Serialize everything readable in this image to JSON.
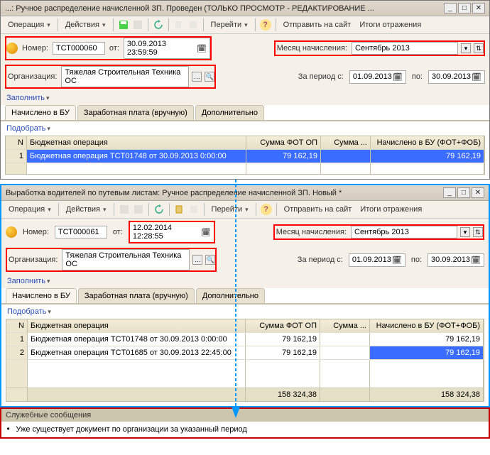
{
  "win1": {
    "title": "...: Ручное распределение начисленной ЗП. Проведен (ТОЛЬКО ПРОСМОТР - РЕДАКТИРОВАНИЕ ...",
    "toolbar": {
      "operation": "Операция",
      "actions": "Действия",
      "goto": "Перейти",
      "send": "Отправить на сайт",
      "totals": "Итоги отражения"
    },
    "row1": {
      "number_label": "Номер:",
      "number": "ТСТ000060",
      "from_label": "от:",
      "from": "30.09.2013 23:59:59",
      "month_label": "Месяц начисления:",
      "month": "Сентябрь 2013"
    },
    "row2": {
      "org_label": "Организация:",
      "org": "Тяжелая Строительная Техника ОС",
      "period_label": "За период с:",
      "period_from": "01.09.2013",
      "period_to_label": "по:",
      "period_to": "30.09.2013"
    },
    "fill": "Заполнить",
    "tabs": {
      "t1": "Начислено в БУ",
      "t2": "Заработная плата (вручную)",
      "t3": "Дополнительно"
    },
    "pick": "Подобрать",
    "cols": {
      "n": "N",
      "op": "Бюджетная операция",
      "fot": "Сумма ФОТ ОП",
      "sum": "Сумма ...",
      "nach": "Начислено в БУ (ФОТ+ФОБ)"
    },
    "rows": [
      {
        "n": "1",
        "op": "Бюджетная операция TCT01748 от 30.09.2013 0:00:00",
        "fot": "79 162,19",
        "sum": "",
        "nach": "79 162,19"
      }
    ]
  },
  "win2": {
    "title": "Выработка водителей по путевым листам: Ручное распределение начисленной ЗП. Новый *",
    "toolbar": {
      "operation": "Операция",
      "actions": "Действия",
      "goto": "Перейти",
      "send": "Отправить на сайт",
      "totals": "Итоги отражения"
    },
    "row1": {
      "number_label": "Номер:",
      "number": "ТСТ000061",
      "from_label": "от:",
      "from": "12.02.2014 12:28:55",
      "month_label": "Месяц начисления:",
      "month": "Сентябрь 2013"
    },
    "row2": {
      "org_label": "Организация:",
      "org": "Тяжелая Строительная Техника ОС",
      "period_label": "За период с:",
      "period_from": "01.09.2013",
      "period_to_label": "по:",
      "period_to": "30.09.2013"
    },
    "fill": "Заполнить",
    "tabs": {
      "t1": "Начислено в БУ",
      "t2": "Заработная плата (вручную)",
      "t3": "Дополнительно"
    },
    "pick": "Подобрать",
    "cols": {
      "n": "N",
      "op": "Бюджетная операция",
      "fot": "Сумма ФОТ ОП",
      "sum": "Сумма ...",
      "nach": "Начислено в БУ (ФОТ+ФОБ)"
    },
    "rows": [
      {
        "n": "1",
        "op": "Бюджетная операция TCT01748 от 30.09.2013 0:00:00",
        "fot": "79 162,19",
        "sum": "",
        "nach": "79 162,19"
      },
      {
        "n": "2",
        "op": "Бюджетная операция TCT01685 от 30.09.2013 22:45:00",
        "fot": "79 162,19",
        "sum": "",
        "nach": "79 162,19"
      }
    ],
    "totals": {
      "fot": "158 324,38",
      "nach": "158 324,38"
    }
  },
  "svc": {
    "title": "Служебные сообщения",
    "msg": "Уже существует документ по организации за указанный период"
  }
}
